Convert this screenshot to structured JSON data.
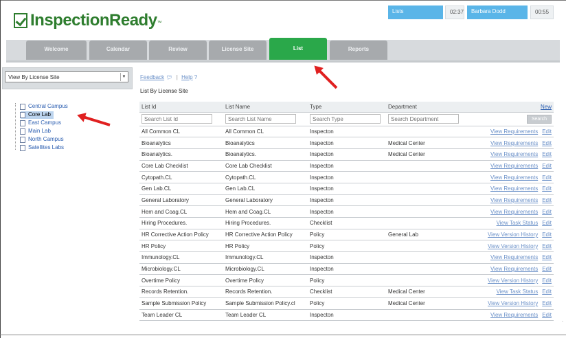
{
  "brand": {
    "name": "InspectionReady",
    "tm": "™",
    "colors": {
      "brand_green": "#2e7d2e",
      "active_tab": "#2aa84a",
      "status_blue": "#5ab5e8",
      "link_blue": "#6a90c8",
      "annotation_red": "#e02020"
    }
  },
  "header": {
    "status_label": "Lists",
    "time_1": "02:37",
    "user_name": "Barbara Dodd",
    "time_2": "00:55"
  },
  "tabs": [
    {
      "label": "Welcome",
      "active": false
    },
    {
      "label": "Calendar",
      "active": false
    },
    {
      "label": "Review",
      "active": false
    },
    {
      "label": "License Site",
      "active": false
    },
    {
      "label": "List",
      "active": true
    },
    {
      "label": "Reports",
      "active": false
    }
  ],
  "sidebar": {
    "view_select": "View By License Site",
    "items": [
      {
        "label": "Central Campus",
        "selected": false
      },
      {
        "label": "Core Lab",
        "selected": true
      },
      {
        "label": "East Campus",
        "selected": false
      },
      {
        "label": "Main Lab",
        "selected": false
      },
      {
        "label": "North Campus",
        "selected": false
      },
      {
        "label": "Satellites Labs",
        "selected": false
      }
    ]
  },
  "main": {
    "feedback_label": "Feedback",
    "feedback_icon": "speech-bubble-icon",
    "separator": "|",
    "help_label": "Help",
    "help_icon": "question-mark-icon",
    "section_title": "List By License Site",
    "table": {
      "headers": [
        "List Id",
        "List Name",
        "Type",
        "Department"
      ],
      "new_label": "New",
      "search_placeholders": [
        "Search List Id",
        "Search List Name",
        "Search Type",
        "Search Department"
      ],
      "search_button": "Search",
      "edit_label": "Edit",
      "rows": [
        {
          "id": "All Common CL",
          "name": "All Common CL",
          "type": "Inspecton",
          "dept": "",
          "action": "View Requirements"
        },
        {
          "id": "Bioanalytics",
          "name": "Bioanalytics",
          "type": "Inspecton",
          "dept": "Medical Center",
          "action": "View Requirements"
        },
        {
          "id": "Bioanalytics.",
          "name": "Bioanalytics.",
          "type": "Inspecton",
          "dept": "Medical Center",
          "action": "View Requirements"
        },
        {
          "id": "Core Lab Checklist",
          "name": "Core Lab Checklist",
          "type": "Inspecton",
          "dept": "",
          "action": "View Requirements"
        },
        {
          "id": "Cytopath.CL",
          "name": "Cytopath.CL",
          "type": "Inspecton",
          "dept": "",
          "action": "View Requirements"
        },
        {
          "id": "Gen Lab.CL",
          "name": "Gen Lab.CL",
          "type": "Inspecton",
          "dept": "",
          "action": "View Requirements"
        },
        {
          "id": "General Laboratory",
          "name": "General Laboratory",
          "type": "Inspecton",
          "dept": "",
          "action": "View Requirements"
        },
        {
          "id": "Hem and Coag.CL",
          "name": "Hem and Coag.CL",
          "type": "Inspecton",
          "dept": "",
          "action": "View Requirements"
        },
        {
          "id": "Hiring Procedures.",
          "name": "Hiring Procedures.",
          "type": "Checklist",
          "dept": "",
          "action": "View Task Status"
        },
        {
          "id": "HR Corrective Action Policy",
          "name": "HR Corrective Action Policy",
          "type": "Policy",
          "dept": "General Lab",
          "action": "View Version History"
        },
        {
          "id": "HR Policy",
          "name": "HR Policy",
          "type": "Policy",
          "dept": "",
          "action": "View Version History"
        },
        {
          "id": "Immunology.CL",
          "name": "Immunology.CL",
          "type": "Inspecton",
          "dept": "",
          "action": "View Requirements"
        },
        {
          "id": "Microbiology.CL",
          "name": "Microbiology.CL",
          "type": "Inspecton",
          "dept": "",
          "action": "View Requirements"
        },
        {
          "id": "Overtime Policy",
          "name": "Overtime Policy",
          "type": "Policy",
          "dept": "",
          "action": "View Version History"
        },
        {
          "id": "Records Retention.",
          "name": "Records Retention.",
          "type": "Checklist",
          "dept": "Medical Center",
          "action": "View Task Status"
        },
        {
          "id": "Sample Submission Policy",
          "name": "Sample Submission Policy.cl",
          "type": "Policy",
          "dept": "Medical Center",
          "action": "View Version History"
        },
        {
          "id": "Team Leader CL",
          "name": "Team Leader CL",
          "type": "Inspecton",
          "dept": "",
          "action": "View Requirements"
        }
      ]
    }
  },
  "misc": {
    "edge_mark": "."
  }
}
